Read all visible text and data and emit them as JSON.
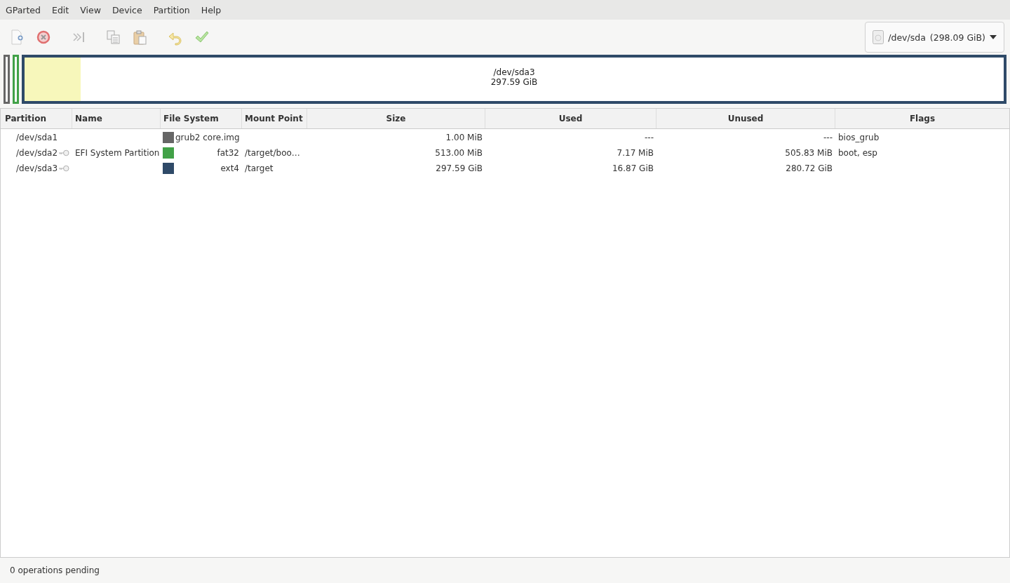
{
  "menu": [
    "GParted",
    "Edit",
    "View",
    "Device",
    "Partition",
    "Help"
  ],
  "device_selector": {
    "label": "/dev/sda",
    "size": "(298.09 GiB)"
  },
  "disk_map": [
    {
      "color": "#666666"
    },
    {
      "color": "#41a147"
    },
    {
      "color": "#2f4a68",
      "level": 0.057,
      "name": "/dev/sda3",
      "size": "297.59 GiB"
    }
  ],
  "table": {
    "columns": [
      "Partition",
      "Name",
      "File System",
      "Mount Point",
      "Size",
      "Used",
      "Unused",
      "Flags"
    ],
    "rows": [
      {
        "partition": "/dev/sda1",
        "mounted": false,
        "name": "",
        "color": "#666666",
        "file_system": "grub2 core.img",
        "mount_point": "",
        "size": "1.00 MiB",
        "used": "---",
        "unused": "---",
        "flags": "bios_grub"
      },
      {
        "partition": "/dev/sda2",
        "mounted": true,
        "name": "EFI System Partition",
        "color": "#41a147",
        "file_system": "fat32",
        "mount_point": "/target/boo…",
        "size": "513.00 MiB",
        "used": "7.17 MiB",
        "unused": "505.83 MiB",
        "flags": "boot, esp"
      },
      {
        "partition": "/dev/sda3",
        "mounted": true,
        "name": "",
        "color": "#2f4a68",
        "file_system": "ext4",
        "mount_point": "/target",
        "size": "297.59 GiB",
        "used": "16.87 GiB",
        "unused": "280.72 GiB",
        "flags": ""
      }
    ]
  },
  "status_bar": "0 operations pending"
}
